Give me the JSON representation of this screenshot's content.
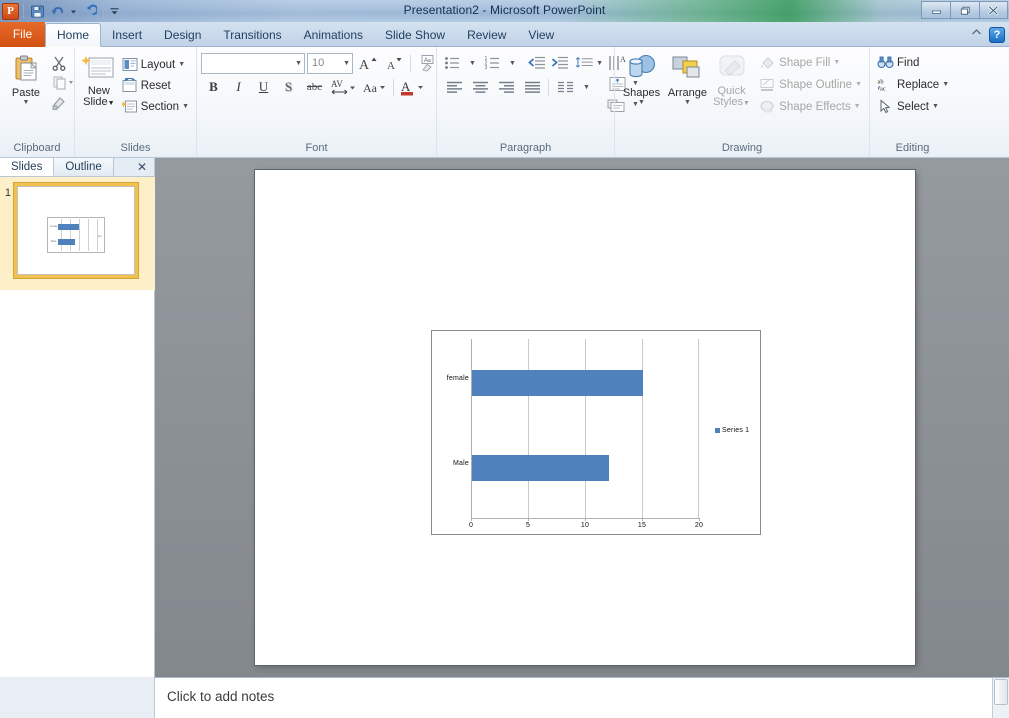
{
  "window": {
    "title": "Presentation2  -  Microsoft PowerPoint",
    "minimize_label": "Minimize",
    "restore_label": "Restore Down",
    "close_label": "Close"
  },
  "quick_access": {
    "app_logo": "powerpoint-logo",
    "app_logo_letter": "P",
    "items": [
      {
        "name": "save-icon",
        "label": "Save"
      },
      {
        "name": "undo-icon",
        "label": "Undo"
      },
      {
        "name": "undo-dropdown-icon",
        "label": "Undo options"
      },
      {
        "name": "redo-icon",
        "label": "Redo"
      },
      {
        "name": "customize-qat-icon",
        "label": "Customize Quick Access Toolbar"
      }
    ]
  },
  "ribbon": {
    "tabs": [
      {
        "label": "File",
        "active": false
      },
      {
        "label": "Home",
        "active": true
      },
      {
        "label": "Insert",
        "active": false
      },
      {
        "label": "Design",
        "active": false
      },
      {
        "label": "Transitions",
        "active": false
      },
      {
        "label": "Animations",
        "active": false
      },
      {
        "label": "Slide Show",
        "active": false
      },
      {
        "label": "Review",
        "active": false
      },
      {
        "label": "View",
        "active": false
      }
    ],
    "minimize_ribbon_label": "Minimize the Ribbon",
    "help_label": "?",
    "groups": {
      "clipboard": {
        "label": "Clipboard",
        "paste": "Paste",
        "cut": "Cut",
        "copy": "Copy",
        "format_painter": "Format Painter",
        "dialog_launcher": "Clipboard dialog box launcher"
      },
      "slides": {
        "label": "Slides",
        "new_slide_line1": "New",
        "new_slide_line2": "Slide",
        "layout": "Layout",
        "reset": "Reset",
        "section": "Section"
      },
      "font": {
        "label": "Font",
        "font_name_value": "",
        "font_name_placeholder": "",
        "font_size_value": "10",
        "grow_font": "Increase Font Size",
        "shrink_font": "Decrease Font Size",
        "clear_formatting": "Clear All Formatting",
        "bold": "B",
        "italic": "I",
        "underline": "U",
        "shadow": "S",
        "strikethrough": "abc",
        "character_spacing": "AV",
        "change_case": "Aa",
        "font_color": "A",
        "dialog_launcher": "Font dialog box launcher"
      },
      "paragraph": {
        "label": "Paragraph",
        "bullets": "Bullets",
        "numbering": "Numbering",
        "decrease_indent": "Decrease List Level",
        "increase_indent": "Increase List Level",
        "line_spacing": "Line Spacing",
        "text_direction": "Text Direction",
        "align_text": "Align Text",
        "convert_smartart": "Convert to SmartArt",
        "align_left": "Align Text Left",
        "align_center": "Center",
        "align_right": "Align Text Right",
        "justify": "Justify",
        "columns": "Columns",
        "dialog_launcher": "Paragraph dialog box launcher"
      },
      "drawing": {
        "label": "Drawing",
        "shapes": "Shapes",
        "arrange": "Arrange",
        "quick_styles_line1": "Quick",
        "quick_styles_line2": "Styles",
        "shape_fill": "Shape Fill",
        "shape_outline": "Shape Outline",
        "shape_effects": "Shape Effects",
        "dialog_launcher": "Drawing dialog box launcher"
      },
      "editing": {
        "label": "Editing",
        "find": "Find",
        "replace": "Replace",
        "select": "Select"
      }
    }
  },
  "slides_panel": {
    "tabs": [
      {
        "label": "Slides",
        "active": true
      },
      {
        "label": "Outline",
        "active": false
      }
    ],
    "close_label": "✕",
    "slide_number": "1"
  },
  "notes": {
    "placeholder": "Click to add notes"
  },
  "chart_data": {
    "type": "bar",
    "orientation": "horizontal",
    "title": "",
    "categories": [
      "Male",
      "female"
    ],
    "values": [
      12,
      15
    ],
    "series": [
      {
        "name": "Series 1",
        "values": [
          12,
          15
        ],
        "color": "#4f81bd"
      }
    ],
    "legend": [
      "Series 1"
    ],
    "legend_position": "right",
    "xlabel": "",
    "ylabel": "",
    "xlim": [
      0,
      20
    ],
    "xticks": [
      0,
      5,
      10,
      15,
      20
    ],
    "xtick_labels": [
      "0",
      "5",
      "10",
      "15",
      "20"
    ],
    "grid": true,
    "grid_axis": "x",
    "plot_background": "#ffffff",
    "border_color": "#8a8a8a"
  }
}
